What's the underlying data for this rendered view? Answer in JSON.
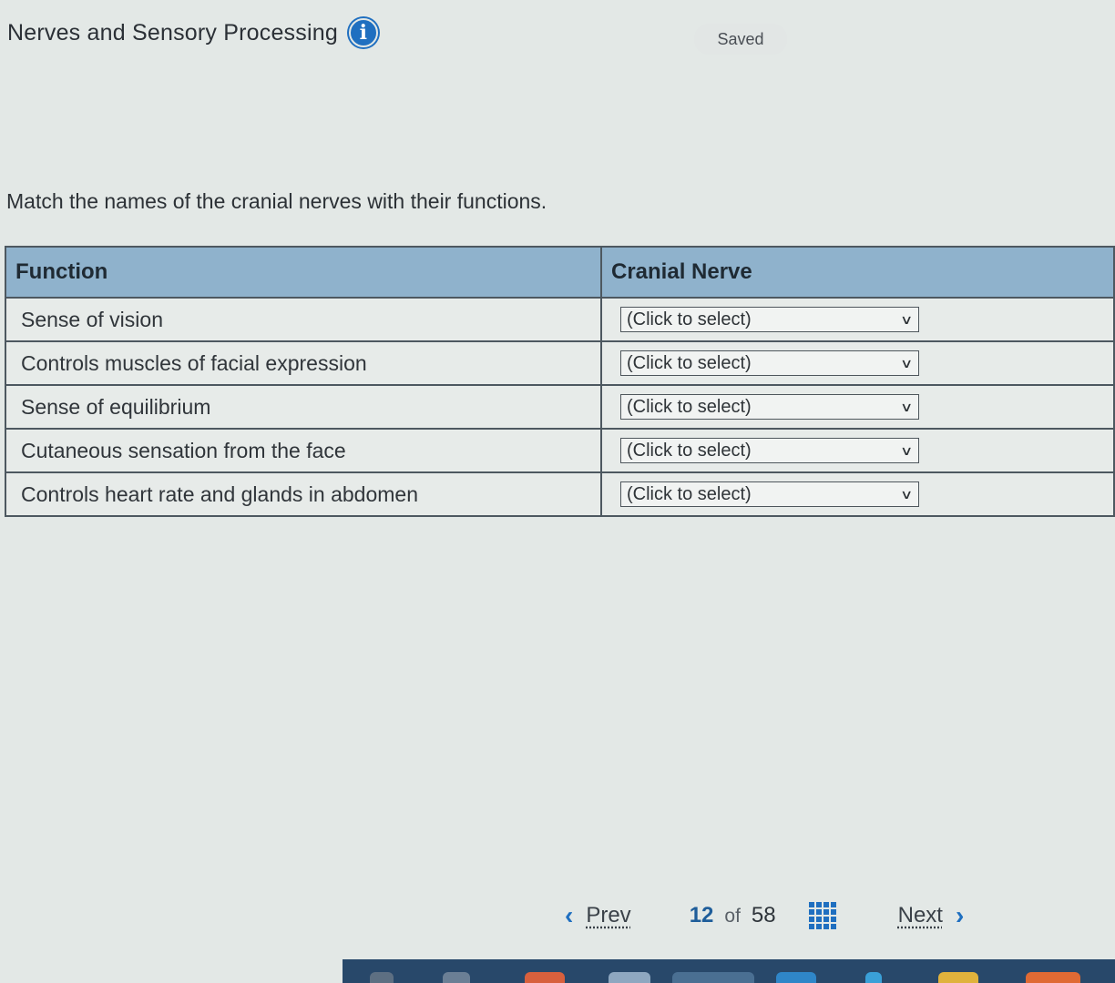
{
  "header": {
    "title": "Nerves and Sensory Processing",
    "info_icon": "info-icon",
    "status": "Saved"
  },
  "question": {
    "instructions": "Match the names of the cranial nerves with their functions."
  },
  "table": {
    "headers": [
      "Function",
      "Cranial Nerve"
    ],
    "rows": [
      {
        "function": "Sense of vision",
        "select": "(Click to select)"
      },
      {
        "function": "Controls muscles of facial expression",
        "select": "(Click to select)"
      },
      {
        "function": "Sense of equilibrium",
        "select": "(Click to select)"
      },
      {
        "function": "Cutaneous sensation from the face",
        "select": "(Click to select)"
      },
      {
        "function": "Controls heart rate and glands in abdomen",
        "select": "(Click to select)"
      }
    ]
  },
  "nav": {
    "prev_label": "Prev",
    "current": "12",
    "of_label": "of",
    "total": "58",
    "next_label": "Next"
  },
  "colors": {
    "accent": "#1f6fc0",
    "table_header": "#8fb2cc",
    "taskbar": "#28486a"
  }
}
